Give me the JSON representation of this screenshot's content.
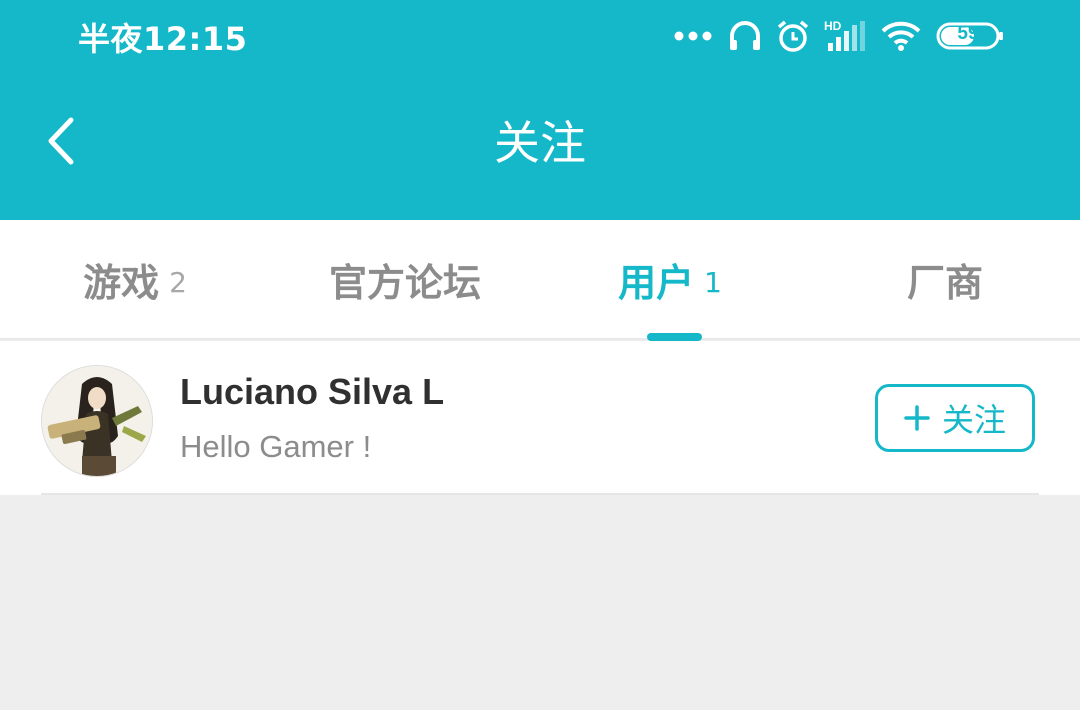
{
  "status_bar": {
    "time": "半夜12:15",
    "battery": "59",
    "icons": [
      "more-dots-icon",
      "headphones-icon",
      "alarm-icon",
      "hd-signal-icon",
      "wifi-icon",
      "battery-icon"
    ],
    "network_label": "HD"
  },
  "header": {
    "title": "关注",
    "back_icon": "chevron-left-icon"
  },
  "tabs": [
    {
      "label": "游戏",
      "count": "2",
      "active": false
    },
    {
      "label": "官方论坛",
      "count": "",
      "active": false
    },
    {
      "label": "用户",
      "count": "1",
      "active": true
    },
    {
      "label": "厂商",
      "count": "",
      "active": false
    }
  ],
  "users": [
    {
      "name": "Luciano Silva L",
      "bio": "Hello Gamer !",
      "follow_label": "关注",
      "follow_icon": "plus-icon"
    }
  ],
  "colors": {
    "accent": "#14b8c8",
    "background": "#eeeeee",
    "text_primary": "#303030",
    "text_secondary": "#8c8c8c"
  }
}
